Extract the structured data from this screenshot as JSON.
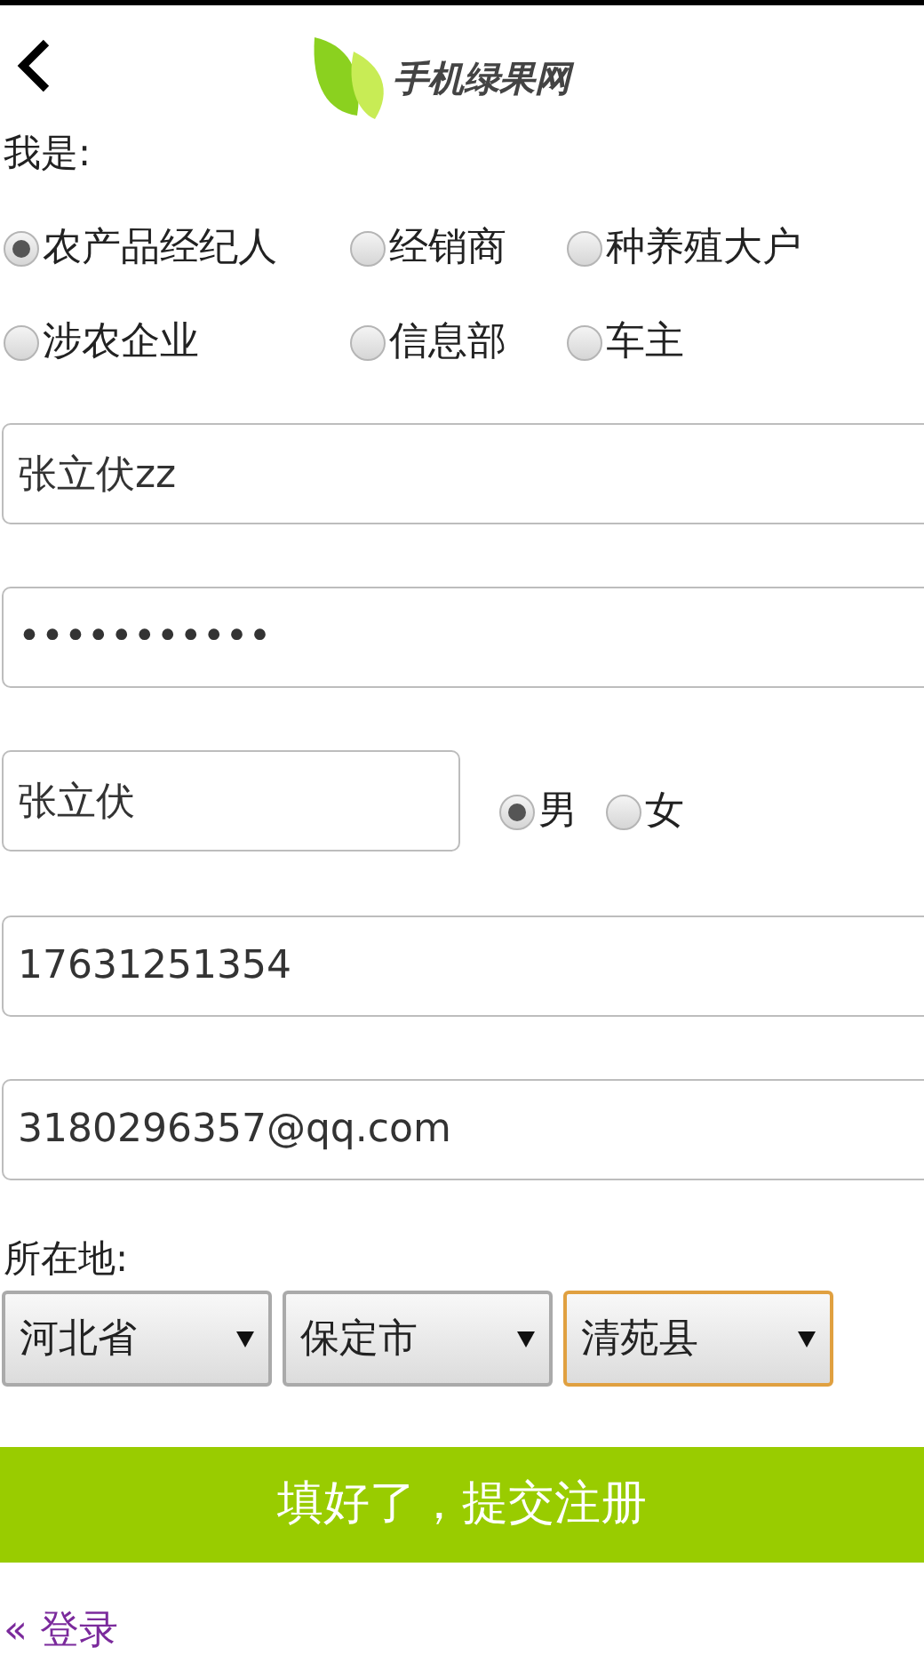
{
  "header": {
    "logo_text": "手机绿果网"
  },
  "role": {
    "label": "我是:",
    "options": [
      {
        "label": "农产品经纪人",
        "selected": true
      },
      {
        "label": "经销商",
        "selected": false
      },
      {
        "label": "种养殖大户",
        "selected": false
      },
      {
        "label": "涉农企业",
        "selected": false
      },
      {
        "label": "信息部",
        "selected": false
      },
      {
        "label": "车主",
        "selected": false
      }
    ]
  },
  "username": {
    "value": "张立伏zz"
  },
  "password": {
    "value": "•••••••••••"
  },
  "real_name": {
    "value": "张立伏"
  },
  "gender": [
    {
      "label": "男",
      "selected": true
    },
    {
      "label": "女",
      "selected": false
    }
  ],
  "phone": {
    "value": "17631251354"
  },
  "email": {
    "value": "3180296357@qq.com"
  },
  "location": {
    "label": "所在地:",
    "selects": [
      {
        "value": "河北省",
        "focused": false
      },
      {
        "value": "保定市",
        "focused": false
      },
      {
        "value": "清苑县",
        "focused": true
      }
    ]
  },
  "submit_button": "填好了，提交注册",
  "login_link": "« 登录"
}
